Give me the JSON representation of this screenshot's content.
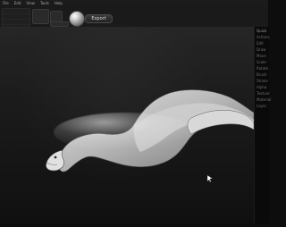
{
  "app": {
    "top_menu": [
      "File",
      "Edit",
      "View",
      "Tools",
      "Help"
    ],
    "left_panel_rows": [
      "",
      "",
      "",
      ""
    ],
    "export_button_label": "Export"
  },
  "toolbar": {
    "blocks": [
      {
        "name": "tool-1",
        "label": ""
      },
      {
        "name": "tool-2",
        "label": ""
      },
      {
        "name": "tool-3",
        "label": ""
      }
    ]
  },
  "right_panel": {
    "items": [
      "Quick",
      "Actions",
      "Edit",
      "Draw",
      "Move",
      "Scale",
      "Rotate",
      "Brush",
      "Stroke",
      "Alpha",
      "Texture",
      "Material",
      "Layer"
    ]
  },
  "icons": {
    "material_preview": "sphere-icon",
    "cursor": "mouse-cursor-icon"
  }
}
